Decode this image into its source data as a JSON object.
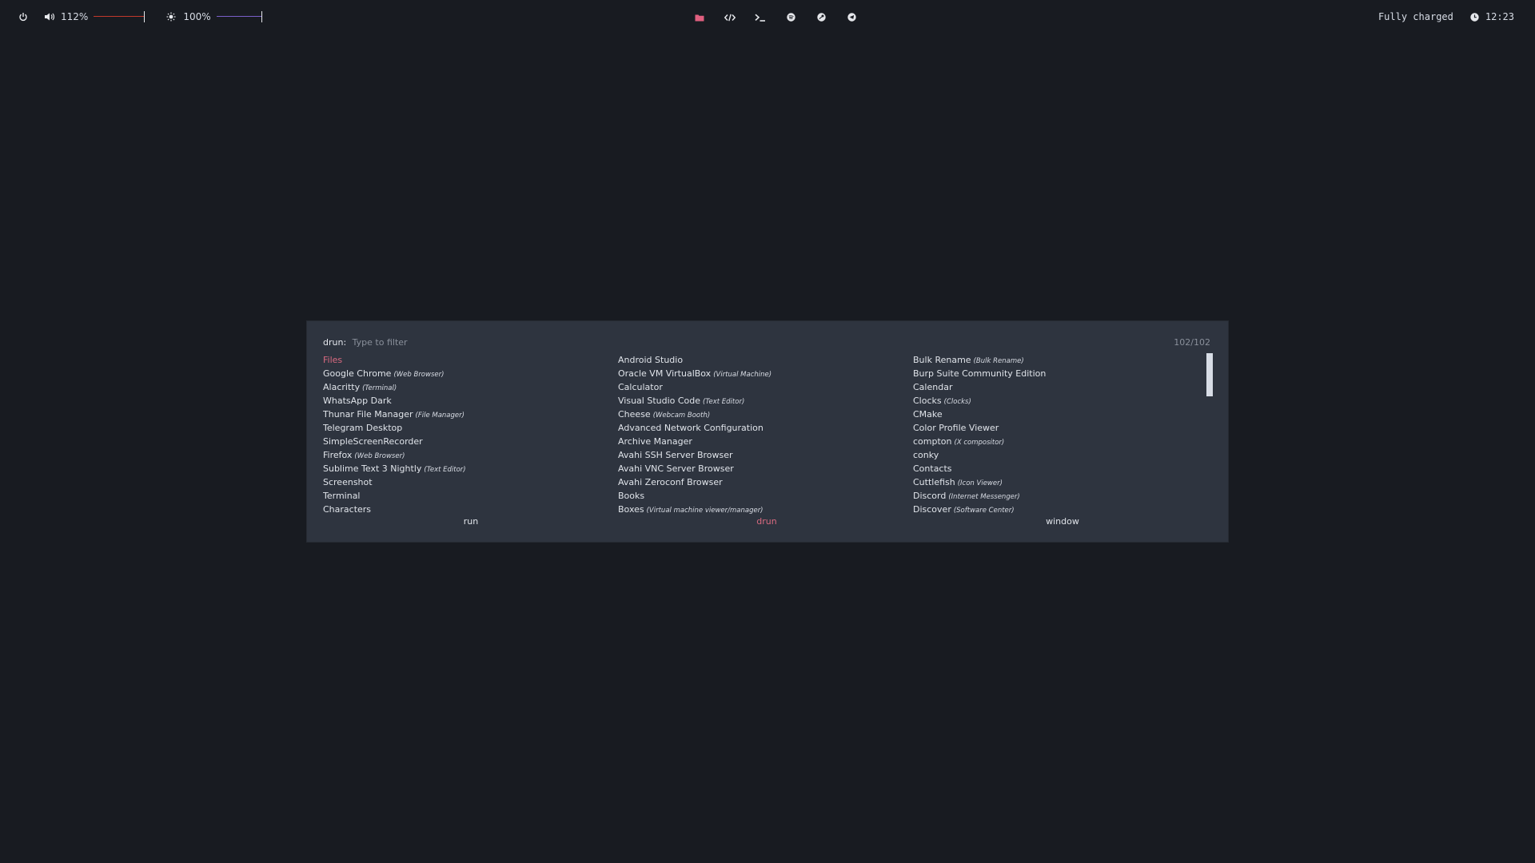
{
  "topbar": {
    "volume": {
      "value_text": "112%",
      "level": 1.12,
      "color": "#c0392b"
    },
    "brightness": {
      "value_text": "100%",
      "level": 1.0,
      "color": "#7a5fc9"
    },
    "battery_status": "Fully charged",
    "clock": "12:23",
    "workspace_icons": [
      "folder-icon",
      "code-icon",
      "terminal-icon",
      "spotify-icon",
      "steam-icon",
      "telegram-icon"
    ],
    "active_workspace_color": "#e05f7f"
  },
  "launcher": {
    "prompt_label": "drun:",
    "placeholder": "Type to filter",
    "counter": "102/102",
    "accent_color": "#d96a80",
    "columns": [
      [
        {
          "name": "Files",
          "desc": "",
          "selected": true
        },
        {
          "name": "Google Chrome",
          "desc": "(Web Browser)"
        },
        {
          "name": "Alacritty",
          "desc": "(Terminal)"
        },
        {
          "name": "WhatsApp Dark",
          "desc": ""
        },
        {
          "name": "Thunar File Manager",
          "desc": "(File Manager)"
        },
        {
          "name": "Telegram Desktop",
          "desc": ""
        },
        {
          "name": "SimpleScreenRecorder",
          "desc": ""
        },
        {
          "name": "Firefox",
          "desc": "(Web Browser)"
        },
        {
          "name": "Sublime Text 3 Nightly",
          "desc": "(Text Editor)"
        },
        {
          "name": "Screenshot",
          "desc": ""
        },
        {
          "name": "Terminal",
          "desc": ""
        },
        {
          "name": "Characters",
          "desc": ""
        }
      ],
      [
        {
          "name": "Android Studio",
          "desc": ""
        },
        {
          "name": "Oracle VM VirtualBox",
          "desc": "(Virtual Machine)"
        },
        {
          "name": "Calculator",
          "desc": ""
        },
        {
          "name": "Visual Studio Code",
          "desc": "(Text Editor)"
        },
        {
          "name": "Cheese",
          "desc": "(Webcam Booth)"
        },
        {
          "name": "Advanced Network Configuration",
          "desc": ""
        },
        {
          "name": "Archive Manager",
          "desc": ""
        },
        {
          "name": "Avahi SSH Server Browser",
          "desc": ""
        },
        {
          "name": "Avahi VNC Server Browser",
          "desc": ""
        },
        {
          "name": "Avahi Zeroconf Browser",
          "desc": ""
        },
        {
          "name": "Books",
          "desc": ""
        },
        {
          "name": "Boxes",
          "desc": "(Virtual machine viewer/manager)"
        }
      ],
      [
        {
          "name": "Bulk Rename",
          "desc": "(Bulk Rename)"
        },
        {
          "name": "Burp Suite Community Edition",
          "desc": ""
        },
        {
          "name": "Calendar",
          "desc": ""
        },
        {
          "name": "Clocks",
          "desc": "(Clocks)"
        },
        {
          "name": "CMake",
          "desc": ""
        },
        {
          "name": "Color Profile Viewer",
          "desc": ""
        },
        {
          "name": "compton",
          "desc": "(X compositor)"
        },
        {
          "name": "conky",
          "desc": ""
        },
        {
          "name": "Contacts",
          "desc": ""
        },
        {
          "name": "Cuttlefish",
          "desc": "(Icon Viewer)"
        },
        {
          "name": "Discord",
          "desc": "(Internet Messenger)"
        },
        {
          "name": "Discover",
          "desc": "(Software Center)"
        }
      ]
    ],
    "modes": [
      {
        "label": "run",
        "active": false
      },
      {
        "label": "drun",
        "active": true
      },
      {
        "label": "window",
        "active": false
      }
    ]
  }
}
